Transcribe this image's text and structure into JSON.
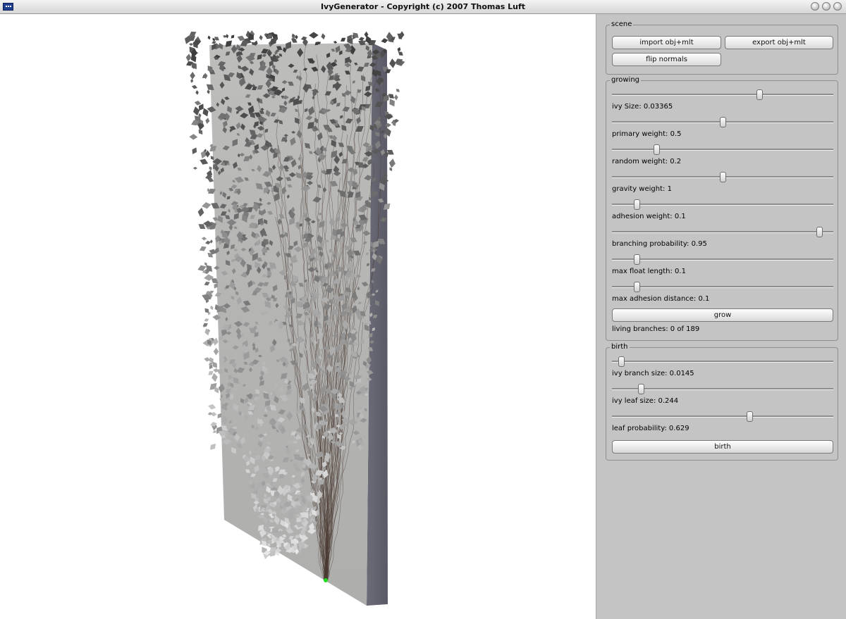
{
  "window": {
    "title": "IvyGenerator  - Copyright (c) 2007 Thomas Luft"
  },
  "colors": {
    "panel": "#c4c4c4",
    "viewport_bg": "#ffffff",
    "seed_point": "#22dd22"
  },
  "scene": {
    "title": "scene",
    "import_label": "import obj+mlt",
    "export_label": "export obj+mlt",
    "flip_label": "flip normals"
  },
  "growing": {
    "title": "growing",
    "sliders": [
      {
        "label": "ivy Size: 0.03365",
        "fraction": 0.665
      },
      {
        "label": "primary weight: 0.5",
        "fraction": 0.5
      },
      {
        "label": "random weight: 0.2",
        "fraction": 0.2
      },
      {
        "label": "gravity weight: 1",
        "fraction": 0.5
      },
      {
        "label": "adhesion weight: 0.1",
        "fraction": 0.11
      },
      {
        "label": "branching probability: 0.95",
        "fraction": 0.935
      },
      {
        "label": "max float length: 0.1",
        "fraction": 0.11
      },
      {
        "label": "max adhesion distance: 0.1",
        "fraction": 0.11
      }
    ],
    "grow_label": "grow",
    "status": "living branches: 0 of 189"
  },
  "birth": {
    "title": "birth",
    "sliders": [
      {
        "label": "ivy branch size: 0.0145",
        "fraction": 0.04
      },
      {
        "label": "ivy leaf size: 0.244",
        "fraction": 0.13
      },
      {
        "label": "leaf probability: 0.629",
        "fraction": 0.62
      }
    ],
    "birth_label": "birth"
  }
}
